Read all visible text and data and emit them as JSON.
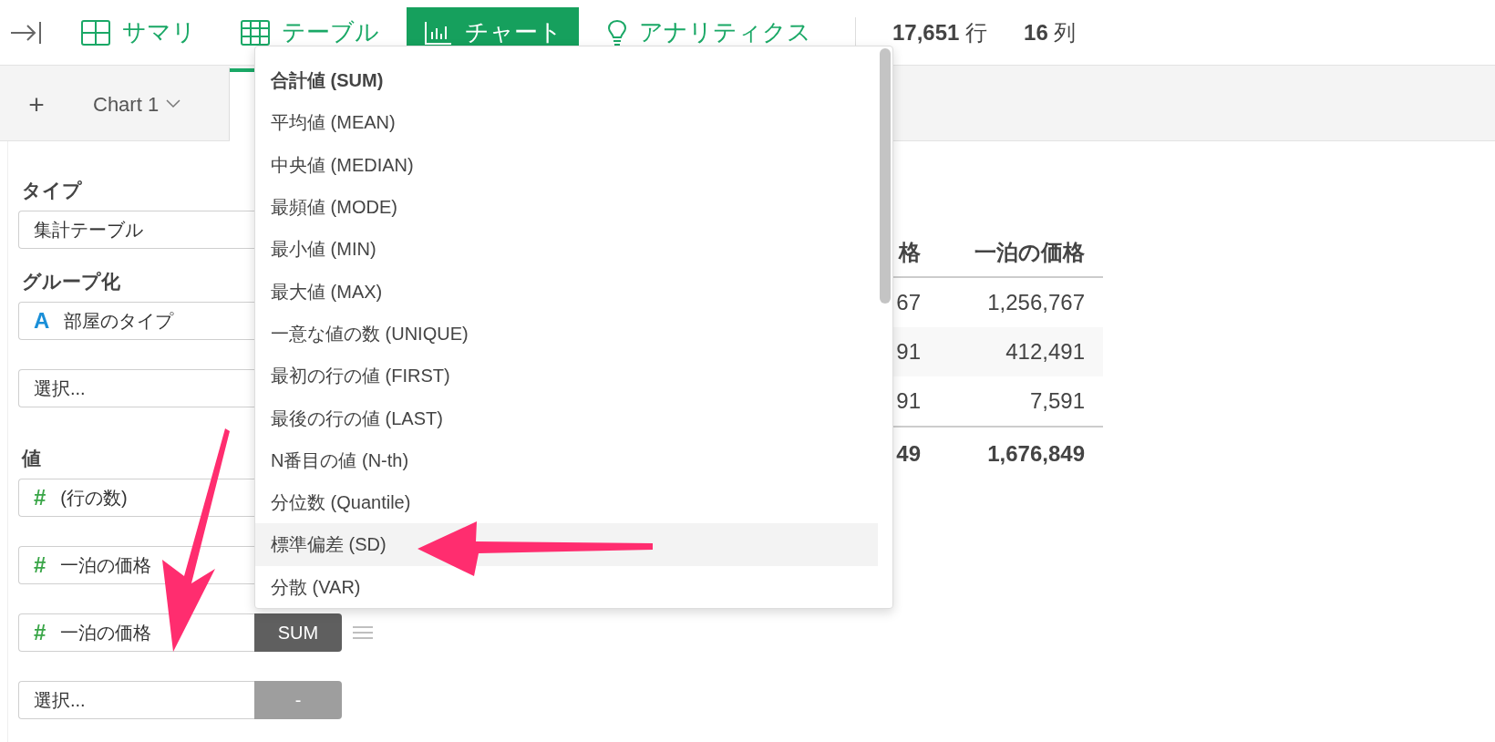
{
  "nav_tabs": [
    {
      "kind": "grid",
      "label": "サマリ",
      "selected": false
    },
    {
      "kind": "table",
      "label": "テーブル",
      "selected": false
    },
    {
      "kind": "chart",
      "label": "チャート",
      "selected": true
    },
    {
      "kind": "bulb",
      "label": "アナリティクス",
      "selected": false
    }
  ],
  "counts": [
    {
      "value": "17,651",
      "unit": "行"
    },
    {
      "value": "16",
      "unit": "列"
    }
  ],
  "add_tab": "+",
  "chart_tabs": [
    {
      "label": "Chart 1",
      "selected": false
    },
    {
      "selected": true
    }
  ],
  "sections": [
    {
      "title": "タイプ",
      "fields": [
        {
          "kind": "plain",
          "value": "集計テーブル"
        }
      ]
    },
    {
      "title": "グループ化",
      "fields": [
        {
          "kind": "text_column",
          "badge": "A",
          "value": "部屋のタイプ"
        },
        {
          "kind": "plain",
          "value": "選択..."
        }
      ]
    },
    {
      "title": "値",
      "fields": [
        {
          "kind": "number_column",
          "badge": "#",
          "value": "(行の数)"
        },
        {
          "kind": "number_column",
          "badge": "#",
          "value": "一泊の価格"
        },
        {
          "kind": "number_column",
          "badge": "#",
          "value": "一泊の価格",
          "aggregate": "SUM",
          "active": true
        },
        {
          "kind": "plain",
          "value": "選択...",
          "aggregate": "-",
          "active": false
        }
      ]
    }
  ],
  "aggregate_menu": {
    "items": [
      {
        "label": "合計値 (SUM)",
        "selected": true,
        "highlighted": false
      },
      {
        "label": "平均値 (MEAN)",
        "selected": false,
        "highlighted": false
      },
      {
        "label": "中央値 (MEDIAN)",
        "selected": false,
        "highlighted": false
      },
      {
        "label": "最頻値 (MODE)",
        "selected": false,
        "highlighted": false
      },
      {
        "label": "最小値 (MIN)",
        "selected": false,
        "highlighted": false
      },
      {
        "label": "最大値 (MAX)",
        "selected": false,
        "highlighted": false
      },
      {
        "label": "一意な値の数 (UNIQUE)",
        "selected": false,
        "highlighted": false
      },
      {
        "label": "最初の行の値 (FIRST)",
        "selected": false,
        "highlighted": false
      },
      {
        "label": "最後の行の値 (LAST)",
        "selected": false,
        "highlighted": false
      },
      {
        "label": "N番目の値 (N-th)",
        "selected": false,
        "highlighted": false
      },
      {
        "label": "分位数 (Quantile)",
        "selected": false,
        "highlighted": false
      },
      {
        "label": "標準偏差 (SD)",
        "selected": false,
        "highlighted": true
      },
      {
        "label": "分散 (VAR)",
        "selected": false,
        "highlighted": false
      }
    ]
  },
  "table": {
    "columns": [
      "格",
      "一泊の価格"
    ],
    "rows": [
      [
        "67",
        "1,256,767"
      ],
      [
        "91",
        "412,491"
      ],
      [
        "91",
        "7,591"
      ]
    ],
    "total": [
      "49",
      "1,676,849"
    ]
  }
}
